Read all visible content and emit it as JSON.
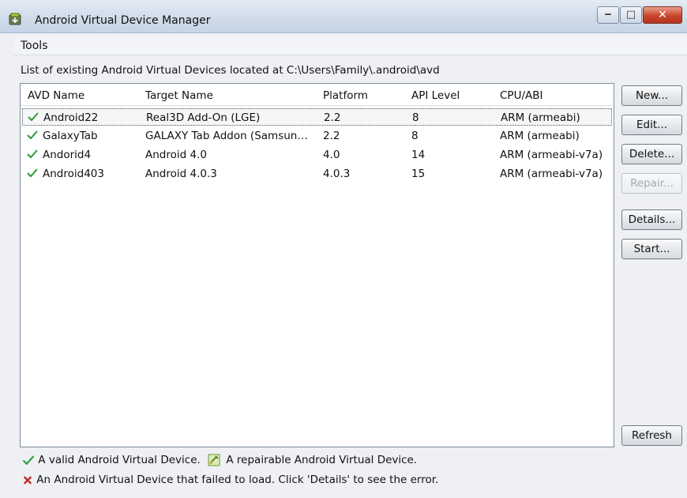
{
  "window": {
    "title": "Android Virtual Device Manager",
    "minimize_glyph": "‒",
    "maximize_glyph": "□",
    "close_glyph": "✕"
  },
  "menu": {
    "tools": "Tools"
  },
  "info": "List of existing Android Virtual Devices located at C:\\Users\\Family\\.android\\avd",
  "table": {
    "headers": [
      "AVD Name",
      "Target Name",
      "Platform",
      "API Level",
      "CPU/ABI"
    ],
    "rows": [
      {
        "name": "Android22",
        "target": "Real3D Add-On (LGE)",
        "platform": "2.2",
        "api": "8",
        "cpu": "ARM (armeabi)",
        "status": "valid",
        "selected": true
      },
      {
        "name": "GalaxyTab",
        "target": "GALAXY Tab Addon (Samsun…",
        "platform": "2.2",
        "api": "8",
        "cpu": "ARM (armeabi)",
        "status": "valid",
        "selected": false
      },
      {
        "name": "Andorid4",
        "target": "Android 4.0",
        "platform": "4.0",
        "api": "14",
        "cpu": "ARM (armeabi-v7a)",
        "status": "valid",
        "selected": false
      },
      {
        "name": "Android403",
        "target": "Android 4.0.3",
        "platform": "4.0.3",
        "api": "15",
        "cpu": "ARM (armeabi-v7a)",
        "status": "valid",
        "selected": false
      }
    ]
  },
  "buttons": {
    "new": "New...",
    "edit": "Edit...",
    "delete": "Delete...",
    "repair": "Repair...",
    "details": "Details...",
    "start": "Start...",
    "refresh": "Refresh"
  },
  "legend": {
    "valid": "A valid Android Virtual Device.",
    "repairable": "A repairable Android Virtual Device.",
    "failed": "An Android Virtual Device that failed to load. Click 'Details' to see the error."
  },
  "icons": {
    "app": "android-package-icon",
    "valid": "green-check-icon",
    "repairable": "repair-wrench-icon",
    "failed": "red-x-icon"
  },
  "colors": {
    "check_green": "#2e9a3a",
    "fail_red": "#c0282a",
    "disabled_text": "#a4a9ae"
  }
}
